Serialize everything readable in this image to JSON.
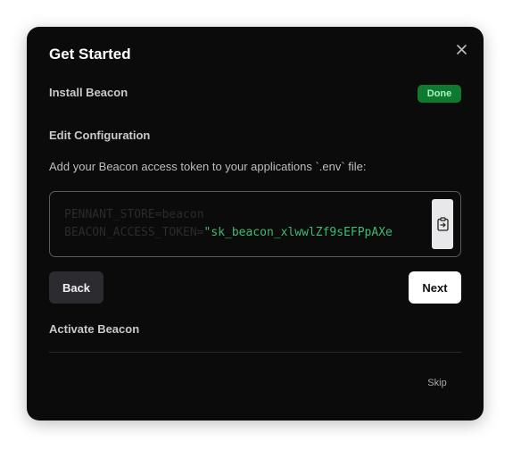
{
  "modal": {
    "title": "Get Started",
    "close_icon": "close-icon"
  },
  "steps": [
    {
      "title": "Install Beacon",
      "status": "Done"
    },
    {
      "title": "Edit Configuration"
    },
    {
      "title": "Activate Beacon"
    }
  ],
  "config": {
    "description": "Add your Beacon access token to your applications `.env` file:",
    "code": {
      "line1": "PENNANT_STORE=beacon",
      "line2_key": "BEACON_ACCESS_TOKEN=",
      "line2_value": "\"sk_beacon_xlwwlZf9sEFPpAXe"
    },
    "copy_icon": "clipboard-icon"
  },
  "actions": {
    "back_label": "Back",
    "next_label": "Next",
    "skip_label": "Skip"
  },
  "colors": {
    "modal_bg": "#0b0b0c",
    "done_badge_bg": "#0e7a2f",
    "token_string": "#3fba6e"
  }
}
